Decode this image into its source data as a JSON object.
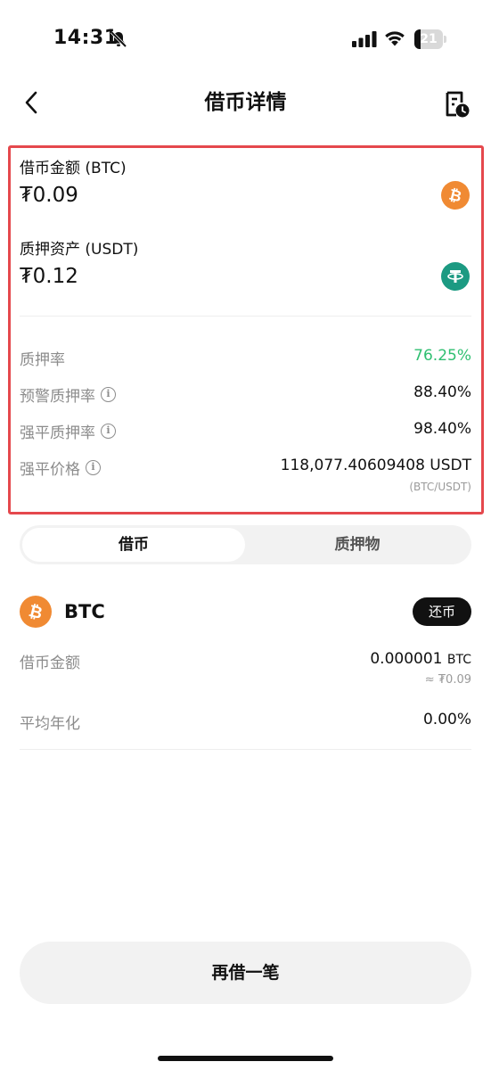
{
  "status_bar": {
    "time": "14:31",
    "battery_level": "21",
    "battery_fraction": 0.21
  },
  "nav": {
    "title": "借币详情",
    "back_icon": "chevron-left-icon",
    "history_icon": "document-clock-icon"
  },
  "summary": {
    "borrow_label": "借币金额 (BTC)",
    "borrow_amount": "₮0.09",
    "borrow_icon": "bitcoin-icon",
    "collateral_label": "质押资产 (USDT)",
    "collateral_amount": "₮0.12",
    "collateral_icon": "tether-icon",
    "rows": [
      {
        "label": "质押率",
        "value": "76.25%",
        "has_info": false,
        "value_color": "#2fbf71"
      },
      {
        "label": "预警质押率",
        "value": "88.40%",
        "has_info": true
      },
      {
        "label": "强平质押率",
        "value": "98.40%",
        "has_info": true
      },
      {
        "label": "强平价格",
        "value": "118,077.40609408 USDT",
        "note": "(BTC/USDT)",
        "has_info": true
      }
    ]
  },
  "tabs": [
    {
      "label": "借币",
      "active": true
    },
    {
      "label": "质押物",
      "active": false
    }
  ],
  "asset": {
    "symbol": "BTC",
    "repay_label": "还币",
    "rows": [
      {
        "label": "借币金额",
        "value": "0.000001",
        "unit": "BTC",
        "note": "≈ ₮0.09"
      },
      {
        "label": "平均年化",
        "value": "0.00%"
      }
    ]
  },
  "footer": {
    "button_label": "再借一笔"
  },
  "colors": {
    "highlight_border": "#e5484d",
    "btc_orange": "#f08a33",
    "usdt_green": "#1c9a82",
    "positive_green": "#2fbf71"
  }
}
